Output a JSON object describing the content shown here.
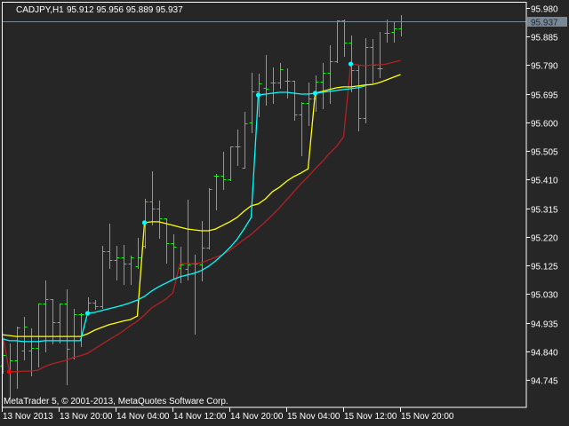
{
  "header": {
    "symbol_timeframe": "CADJPY,H1",
    "ohlc_text": "95.912 95.956 95.889 95.937"
  },
  "copyright": "MetaTrader 5, © 2001-2013, MetaQuotes Software Corp.",
  "colors": {
    "background": "#262626",
    "bars": "#00ff00",
    "axis": "#ffffff",
    "yellow_line": "#ffff00",
    "cyan_line": "#00ffff",
    "red_line": "#b22222",
    "price_line": "#778899",
    "price_label_bg": "#778899"
  },
  "chart_data": {
    "type": "ohlc",
    "title": "CADJPY,H1",
    "ylim": [
      94.68,
      96.006
    ],
    "current_price": "95.937",
    "y_ticks": [
      "95.980",
      "95.885",
      "95.790",
      "95.695",
      "95.600",
      "95.505",
      "95.410",
      "95.315",
      "95.220",
      "95.125",
      "95.030",
      "94.935",
      "94.840",
      "94.745"
    ],
    "x_ticks": [
      {
        "bar": 0,
        "label": "13 Nov 2013"
      },
      {
        "bar": 8,
        "label": "13 Nov 20:00"
      },
      {
        "bar": 16,
        "label": "14 Nov 04:00"
      },
      {
        "bar": 24,
        "label": "14 Nov 12:00"
      },
      {
        "bar": 32,
        "label": "14 Nov 20:00"
      },
      {
        "bar": 40,
        "label": "15 Nov 04:00"
      },
      {
        "bar": 48,
        "label": "15 Nov 12:00"
      },
      {
        "bar": 56,
        "label": "15 Nov 20:00"
      }
    ],
    "bars_ohlc": [
      [
        94.792,
        94.886,
        94.769,
        94.827
      ],
      [
        94.772,
        94.866,
        94.686,
        94.81
      ],
      [
        94.81,
        94.922,
        94.718,
        94.919
      ],
      [
        94.842,
        94.954,
        94.813,
        94.922
      ],
      [
        94.842,
        94.916,
        94.76,
        94.851
      ],
      [
        94.851,
        94.998,
        94.789,
        94.998
      ],
      [
        94.998,
        95.075,
        94.839,
        95.013
      ],
      [
        95.013,
        95.013,
        94.866,
        94.937
      ],
      [
        94.937,
        94.998,
        94.869,
        94.998
      ],
      [
        94.998,
        95.046,
        94.73,
        94.848
      ],
      [
        94.819,
        94.981,
        94.816,
        94.963
      ],
      [
        94.963,
        94.966,
        94.857,
        94.963
      ],
      [
        94.963,
        95.019,
        94.966,
        95.001
      ],
      [
        95.001,
        95.01,
        94.981,
        94.99
      ],
      [
        94.99,
        95.19,
        94.984,
        95.172
      ],
      [
        95.172,
        95.264,
        95.116,
        95.143
      ],
      [
        95.143,
        95.19,
        95.078,
        95.152
      ],
      [
        95.152,
        95.193,
        95.063,
        95.131
      ],
      [
        95.131,
        95.158,
        95.063,
        95.152
      ],
      [
        95.122,
        95.217,
        95.116,
        95.152
      ],
      [
        95.19,
        95.346,
        95.184,
        95.337
      ],
      [
        95.337,
        95.438,
        95.261,
        95.314
      ],
      [
        95.314,
        95.34,
        95.217,
        95.281
      ],
      [
        95.281,
        95.281,
        95.134,
        95.199
      ],
      [
        95.199,
        95.228,
        95.081,
        95.187
      ],
      [
        95.116,
        95.187,
        95.069,
        95.128
      ],
      [
        95.113,
        95.343,
        95.078,
        95.128
      ],
      [
        95.131,
        95.161,
        94.898,
        95.131
      ],
      [
        95.128,
        95.273,
        95.075,
        95.184
      ],
      [
        95.184,
        95.382,
        95.181,
        95.379
      ],
      [
        95.423,
        95.429,
        95.311,
        95.423
      ],
      [
        95.423,
        95.502,
        95.379,
        95.411
      ],
      [
        95.411,
        95.52,
        95.408,
        95.52
      ],
      [
        95.52,
        95.576,
        95.458,
        95.52
      ],
      [
        95.449,
        95.635,
        95.449,
        95.597
      ],
      [
        95.6,
        95.765,
        95.567,
        95.703
      ],
      [
        95.703,
        95.762,
        95.62,
        95.729
      ],
      [
        95.715,
        95.824,
        95.659,
        95.712
      ],
      [
        95.732,
        95.782,
        95.665,
        95.732
      ],
      [
        95.732,
        95.797,
        95.715,
        95.777
      ],
      [
        95.738,
        95.78,
        95.682,
        95.738
      ],
      [
        95.738,
        95.738,
        95.609,
        95.626
      ],
      [
        95.626,
        95.667,
        95.491,
        95.665
      ],
      [
        95.665,
        95.732,
        95.591,
        95.679
      ],
      [
        95.679,
        95.756,
        95.638,
        95.735
      ],
      [
        95.735,
        95.797,
        95.647,
        95.765
      ],
      [
        95.765,
        95.856,
        95.665,
        95.803
      ],
      [
        95.803,
        95.939,
        95.8,
        95.939
      ],
      [
        95.939,
        95.942,
        95.821,
        95.865
      ],
      [
        95.865,
        95.889,
        95.703,
        95.774
      ],
      [
        95.774,
        95.788,
        95.573,
        95.614
      ],
      [
        95.614,
        95.88,
        95.6,
        95.85
      ],
      [
        95.85,
        95.877,
        95.732,
        95.791
      ],
      [
        95.78,
        95.9,
        95.75,
        95.78
      ],
      [
        95.897,
        95.942,
        95.868,
        95.897
      ],
      [
        95.9,
        95.933,
        95.868,
        95.912
      ],
      [
        95.912,
        95.956,
        95.889,
        95.937
      ]
    ],
    "series": [
      {
        "name": "yellow",
        "color": "#ffff00",
        "values": [
          94.895,
          94.892,
          94.889,
          94.889,
          94.889,
          94.889,
          94.889,
          94.889,
          94.889,
          94.889,
          94.889,
          94.889,
          94.898,
          94.91,
          94.919,
          94.928,
          94.934,
          94.94,
          94.945,
          94.957,
          95.267,
          95.27,
          95.27,
          95.264,
          95.258,
          95.252,
          95.246,
          95.243,
          95.24,
          95.24,
          95.246,
          95.258,
          95.27,
          95.284,
          95.305,
          95.323,
          95.329,
          95.346,
          95.37,
          95.385,
          95.405,
          95.42,
          95.432,
          95.446,
          95.697,
          95.703,
          95.709,
          95.715,
          95.718,
          95.718,
          95.721,
          95.724,
          95.726,
          95.732,
          95.741,
          95.75,
          95.759
        ]
      },
      {
        "name": "cyan",
        "color": "#00ffff",
        "values": [
          94.881,
          94.875,
          94.875,
          94.872,
          94.872,
          94.872,
          94.875,
          94.875,
          94.875,
          94.875,
          94.875,
          94.875,
          94.966,
          94.969,
          94.975,
          94.981,
          94.987,
          94.993,
          95.001,
          95.01,
          95.022,
          95.04,
          95.054,
          95.066,
          95.078,
          95.087,
          95.093,
          95.099,
          95.108,
          95.122,
          95.14,
          95.161,
          95.184,
          95.211,
          95.246,
          95.284,
          95.691,
          95.694,
          95.697,
          95.7,
          95.7,
          95.697,
          95.694,
          95.694,
          95.697,
          95.7,
          95.703,
          95.706,
          95.709,
          95.712,
          95.715,
          95.721,
          null,
          null,
          null,
          null,
          null
        ]
      },
      {
        "name": "red",
        "color": "#b22222",
        "values": [
          94.907,
          94.772,
          94.772,
          94.774,
          94.774,
          94.777,
          94.789,
          94.798,
          94.804,
          94.81,
          94.819,
          94.825,
          94.833,
          94.848,
          94.863,
          94.878,
          94.892,
          94.907,
          94.925,
          94.94,
          94.96,
          94.984,
          94.998,
          95.013,
          95.034,
          95.131,
          95.131,
          95.131,
          95.134,
          95.143,
          95.152,
          95.161,
          95.175,
          95.193,
          95.211,
          95.228,
          95.249,
          95.27,
          95.293,
          95.317,
          95.343,
          95.37,
          95.396,
          95.42,
          95.446,
          95.47,
          95.497,
          95.52,
          95.553,
          95.794,
          95.791,
          95.788,
          95.791,
          95.791,
          95.794,
          95.8,
          95.806
        ]
      }
    ],
    "signal_dots": [
      {
        "bar": 1,
        "series": "red",
        "color": "#ff0000"
      },
      {
        "bar": 12,
        "series": "cyan",
        "color": "#00ffff"
      },
      {
        "bar": 20,
        "series": "yellow",
        "color": "#00ffff"
      },
      {
        "bar": 36,
        "series": "cyan",
        "color": "#00ffff"
      },
      {
        "bar": 44,
        "series": "yellow",
        "color": "#00ffff"
      },
      {
        "bar": 49,
        "series": "red",
        "color": "#00ffff"
      }
    ]
  }
}
